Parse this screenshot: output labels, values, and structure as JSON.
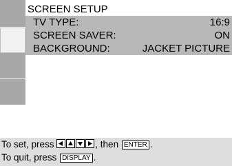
{
  "menu": {
    "title": "SCREEN SETUP",
    "items": [
      {
        "label": "TV TYPE:",
        "value": "16:9"
      },
      {
        "label": "SCREEN SAVER:",
        "value": "ON"
      },
      {
        "label": "BACKGROUND:",
        "value": "JACKET PICTURE"
      }
    ]
  },
  "footer": {
    "line1_prefix": "To set, press",
    "line1_mid": ", then",
    "enter_key": "ENTER",
    "line1_suffix": ".",
    "line2_prefix": "To quit, press",
    "display_key": "DISPLAY",
    "line2_suffix": "."
  },
  "icons": [
    "left-arrow-icon",
    "up-arrow-icon",
    "down-arrow-icon",
    "right-arrow-icon"
  ],
  "colors": {
    "tab_gray": "#a8a8a8",
    "row_gray": "#b8b8b8",
    "footer_gray": "#dedede"
  }
}
